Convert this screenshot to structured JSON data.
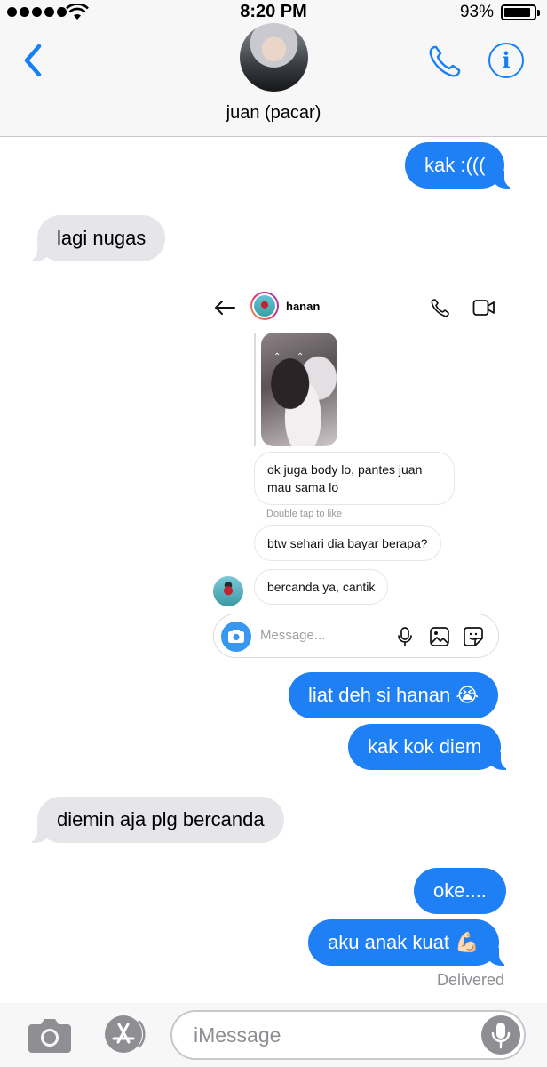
{
  "status_bar": {
    "time": "8:20 PM",
    "battery": "93%",
    "battery_level": 0.93
  },
  "header": {
    "contact_name": "juan (pacar)",
    "info_glyph": "i",
    "accent_color": "#1680f6"
  },
  "messages": [
    {
      "side": "sent",
      "text": "kak :((("
    },
    {
      "side": "received",
      "text": "lagi nugas"
    },
    {
      "side": "sent",
      "text": "liat deh si hanan 😭"
    },
    {
      "side": "sent",
      "text": "kak kok diem"
    },
    {
      "side": "received",
      "text": "diemin aja plg bercanda"
    },
    {
      "side": "sent",
      "text": "oke...."
    },
    {
      "side": "sent",
      "text": "aku anak kuat 💪🏻"
    }
  ],
  "delivered_label": "Delivered",
  "embedded_screenshot": {
    "username": "hanan",
    "messages": [
      "ok juga body lo, pantes juan mau sama lo",
      "btw sehari dia bayar berapa?",
      "bercanda ya, cantik"
    ],
    "hint": "Double tap to like",
    "input_placeholder": "Message..."
  },
  "bottom_bar": {
    "input_placeholder": "iMessage"
  }
}
